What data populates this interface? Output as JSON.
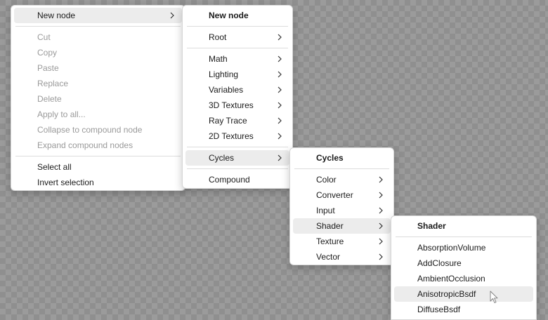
{
  "colors": {
    "menu_bg": "#ffffff",
    "highlight": "#ececec",
    "text": "#1b1b1b",
    "disabled_text": "#9a9a9a",
    "separator": "#dcdcdc"
  },
  "main_menu": {
    "new_node": "New node",
    "edit_items": [
      {
        "label": "Cut"
      },
      {
        "label": "Copy"
      },
      {
        "label": "Paste"
      },
      {
        "label": "Replace"
      },
      {
        "label": "Delete"
      },
      {
        "label": "Apply to all..."
      },
      {
        "label": "Collapse to compound node"
      },
      {
        "label": "Expand compound nodes"
      }
    ],
    "selection_items": [
      {
        "label": "Select all"
      },
      {
        "label": "Invert selection"
      }
    ]
  },
  "new_node_menu": {
    "title": "New node",
    "root": "Root",
    "categories": [
      {
        "label": "Math"
      },
      {
        "label": "Lighting"
      },
      {
        "label": "Variables"
      },
      {
        "label": "3D Textures"
      },
      {
        "label": "Ray Trace"
      },
      {
        "label": "2D Textures"
      }
    ],
    "cycles": "Cycles",
    "compound": "Compound"
  },
  "cycles_menu": {
    "title": "Cycles",
    "items": [
      {
        "label": "Color"
      },
      {
        "label": "Converter"
      },
      {
        "label": "Input"
      },
      {
        "label": "Shader"
      },
      {
        "label": "Texture"
      },
      {
        "label": "Vector"
      }
    ]
  },
  "shader_menu": {
    "title": "Shader",
    "items": [
      {
        "label": "AbsorptionVolume"
      },
      {
        "label": "AddClosure"
      },
      {
        "label": "AmbientOcclusion"
      },
      {
        "label": "AnisotropicBsdf"
      },
      {
        "label": "DiffuseBsdf"
      }
    ]
  }
}
